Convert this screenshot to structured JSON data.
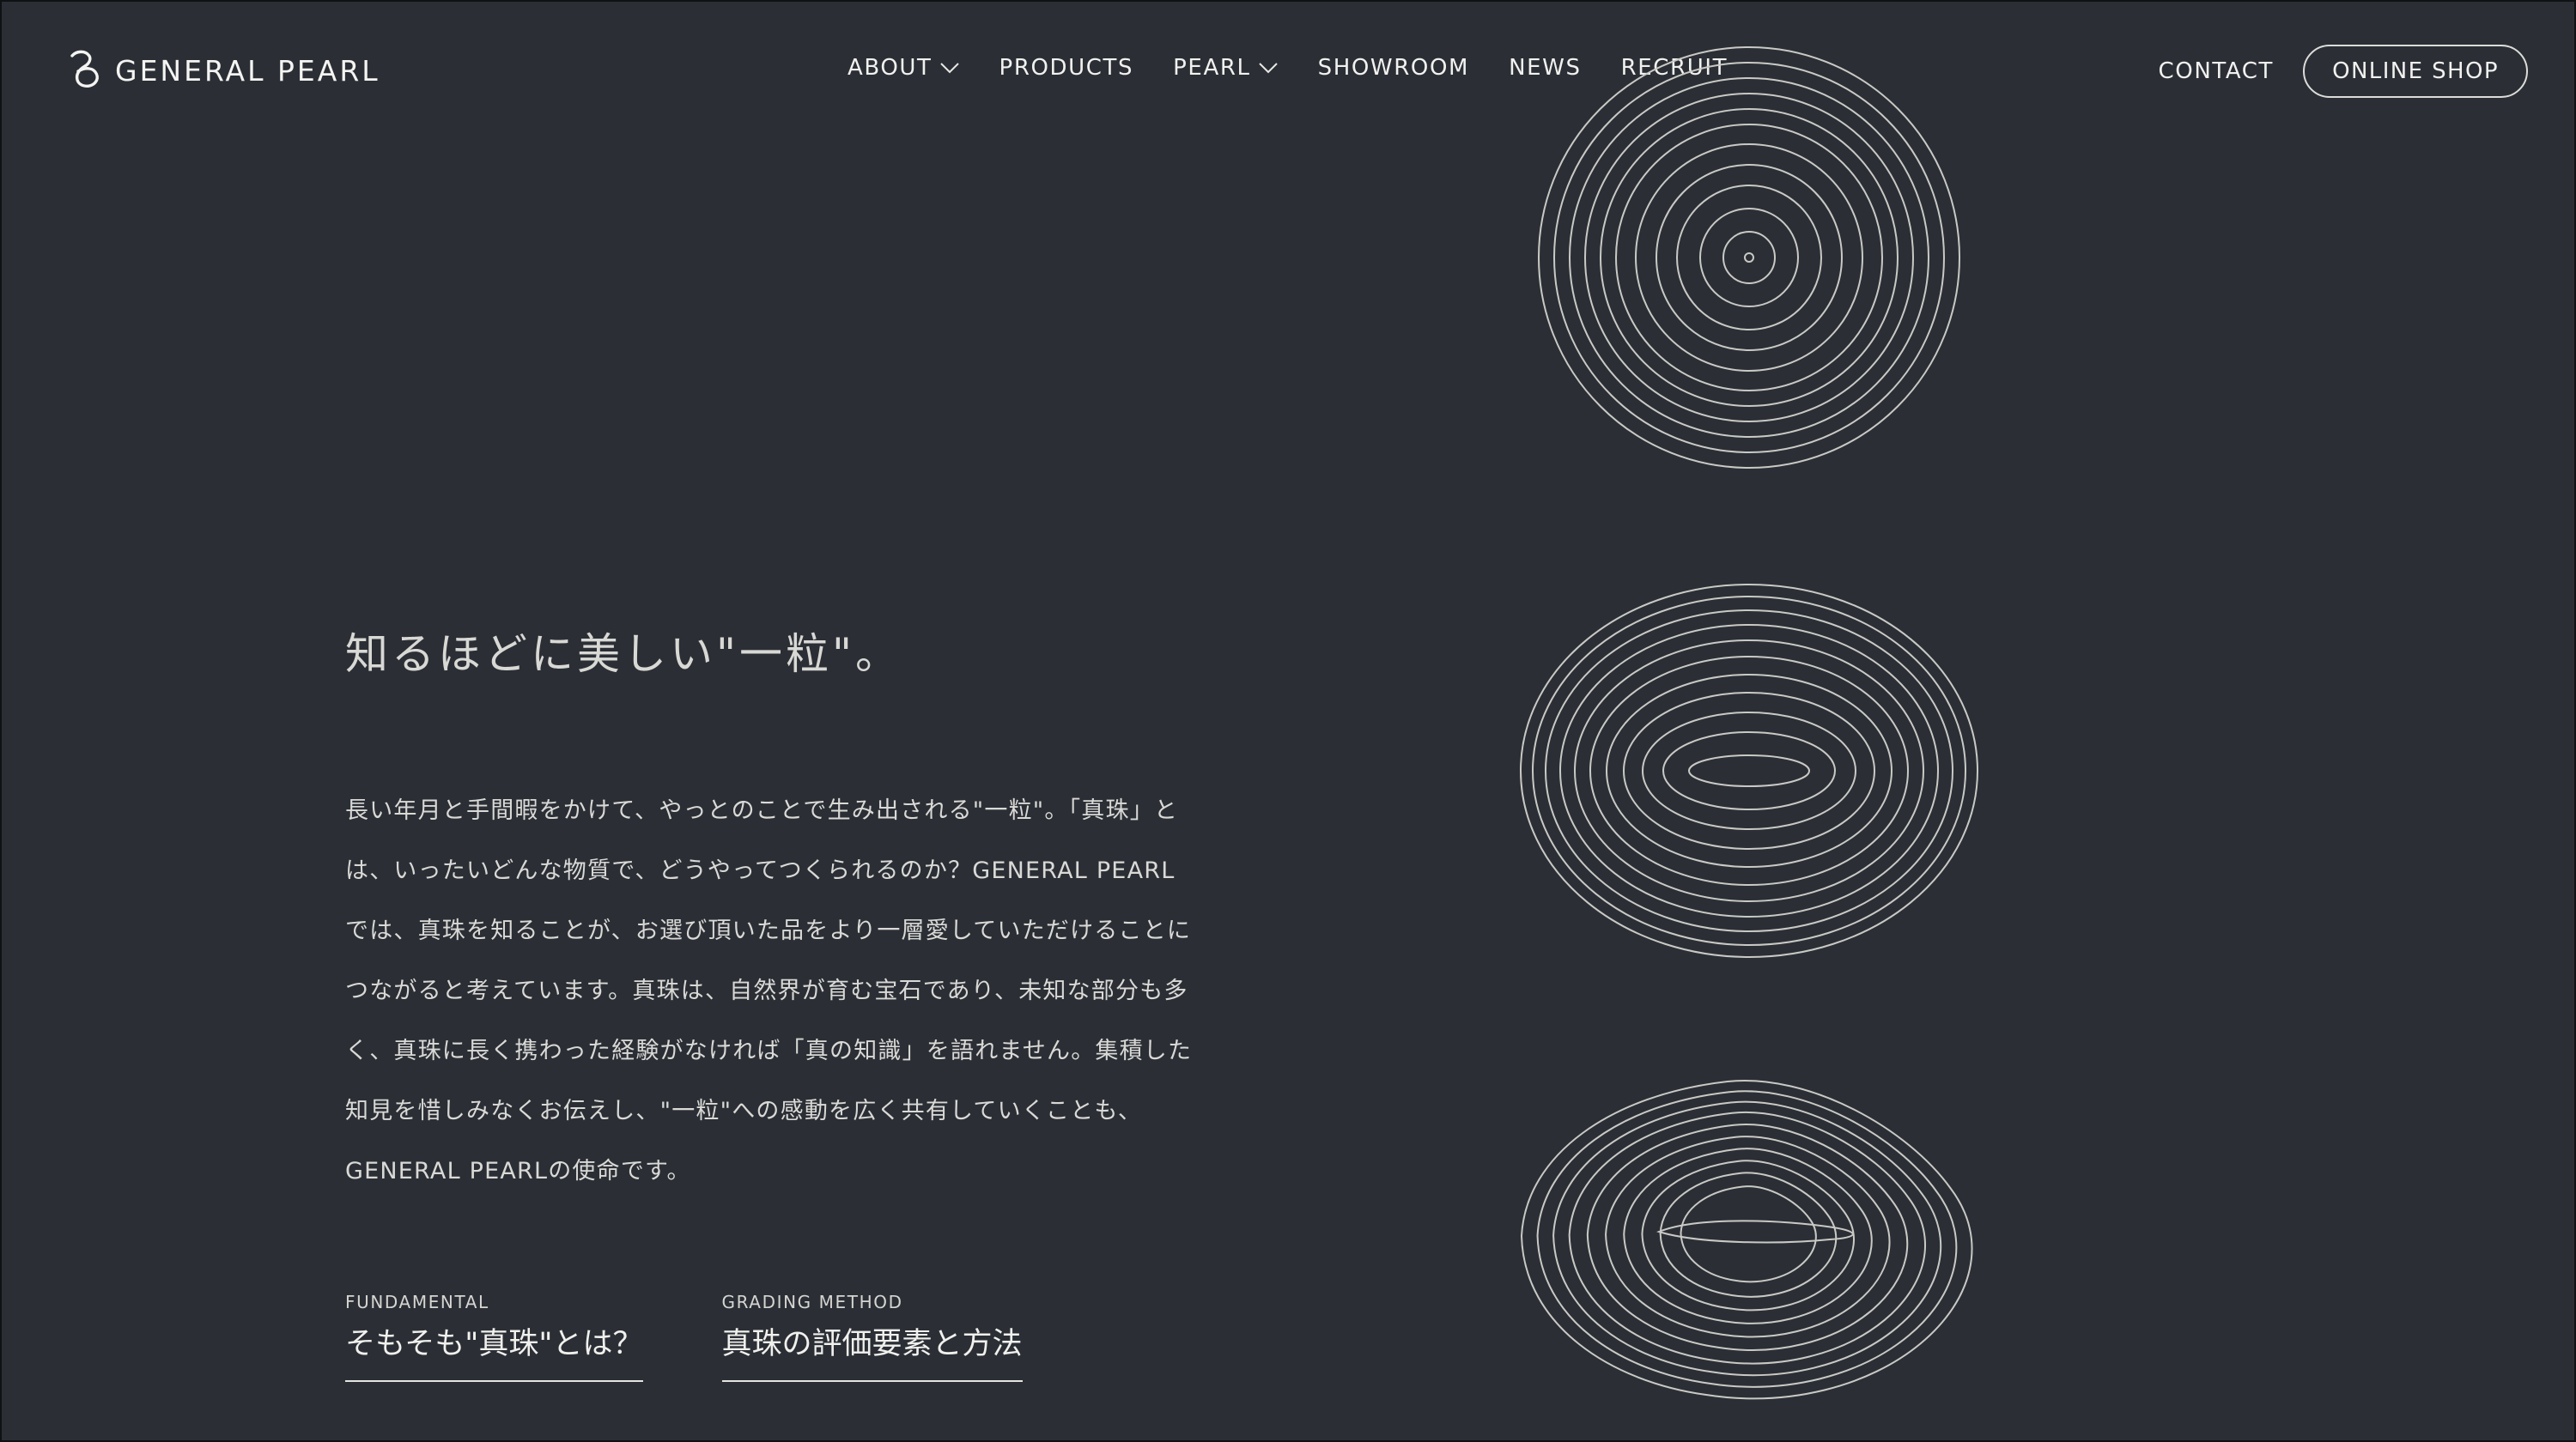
{
  "brand": {
    "name": "GENERAL PEARL"
  },
  "navigation": {
    "items": [
      {
        "label": "ABOUT",
        "has_dropdown": true
      },
      {
        "label": "PRODUCTS",
        "has_dropdown": false
      },
      {
        "label": "PEARL",
        "has_dropdown": true
      },
      {
        "label": "SHOWROOM",
        "has_dropdown": false
      },
      {
        "label": "NEWS",
        "has_dropdown": false
      },
      {
        "label": "RECRUIT",
        "has_dropdown": false
      }
    ],
    "contact_label": "CONTACT",
    "shop_label": "ONLINE SHOP"
  },
  "hero": {
    "title": "知るほどに美しい\"一粒\"。",
    "body": "長い年月と手間暇をかけて、やっとのことで生み出される\"一粒\"。「真珠」とは、いったいどんな物質で、どうやってつくられるのか？GENERAL PEARLでは、真珠を知ることが、お選び頂いた品をより一層愛していただけることにつながると考えています。真珠は、自然界が育む宝石であり、未知な部分も多く、真珠に長く携わった経験がなければ「真の知識」を語れません。集積した知見を惜しみなくお伝えし、\"一粒\"への感動を広く共有していくことも、GENERAL PEARLの使命です。"
  },
  "links": [
    {
      "kicker": "FUNDAMENTAL",
      "title": "そもそも\"真珠\"とは？"
    },
    {
      "kicker": "GRADING METHOD",
      "title": "真珠の評価要素と方法"
    }
  ],
  "decorations": {
    "icons": [
      "logo-mark-icon",
      "chevron-down-icon",
      "round-pearl-contour-icon",
      "oval-pearl-contour-icon",
      "teardrop-pearl-contour-icon"
    ],
    "colors": {
      "background": "#2b2f35",
      "foreground": "#f1f1ef",
      "contour_lines": "#c9c9c5"
    }
  }
}
